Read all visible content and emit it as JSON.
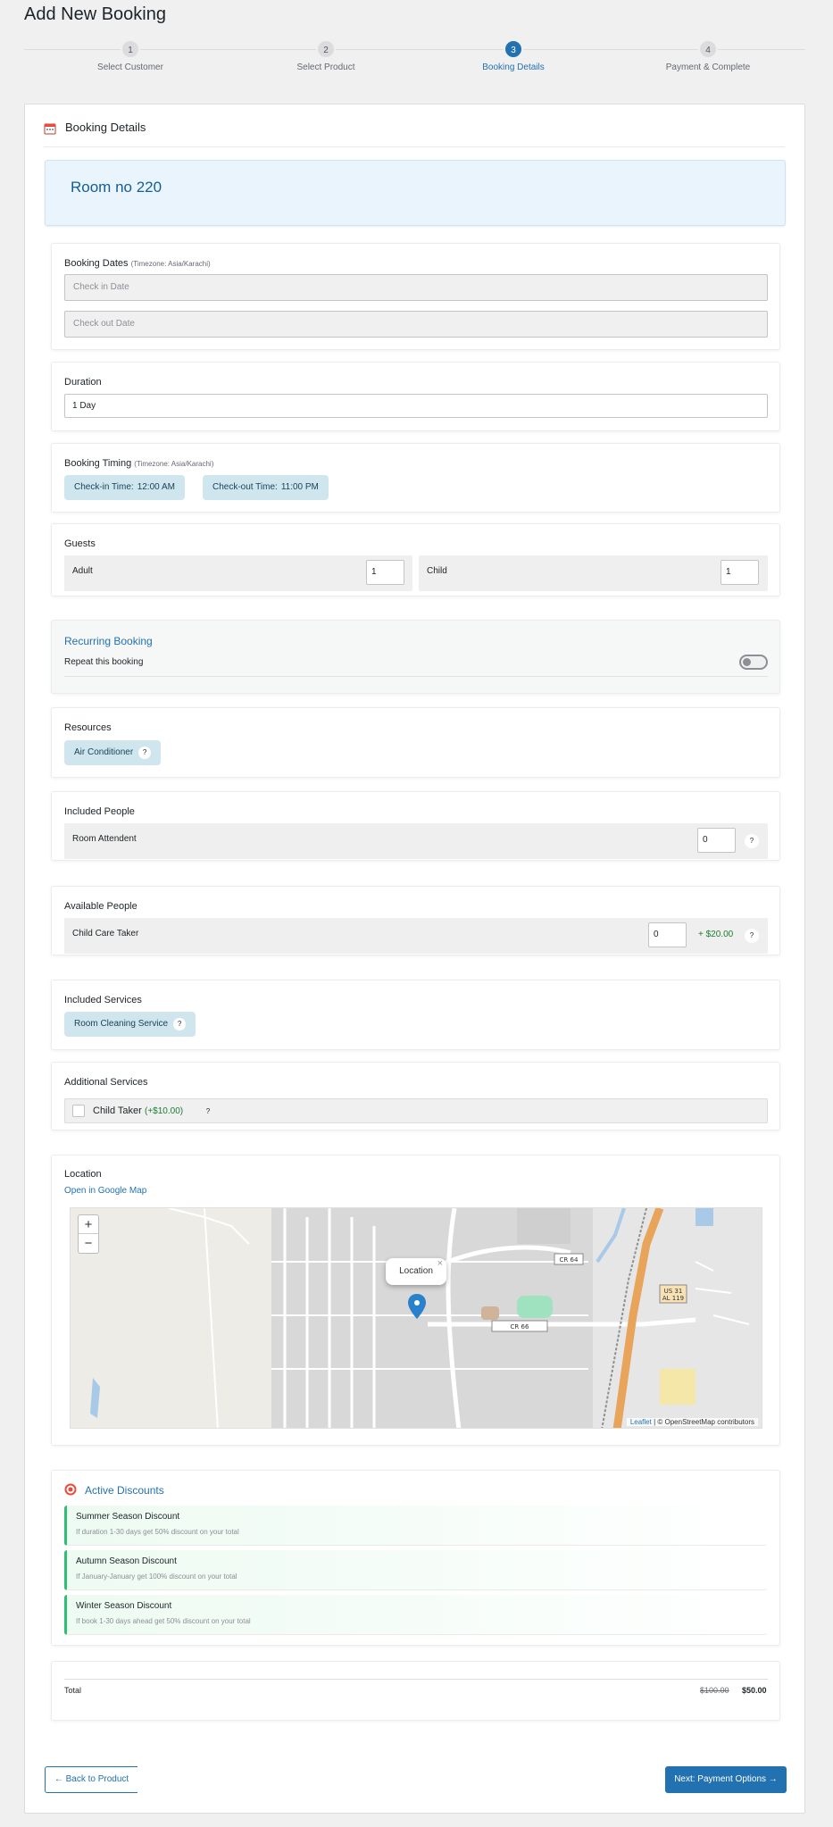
{
  "page": {
    "title": "Add New Booking"
  },
  "steps": [
    {
      "num": "1",
      "label": "Select Customer"
    },
    {
      "num": "2",
      "label": "Select Product"
    },
    {
      "num": "3",
      "label": "Booking Details"
    },
    {
      "num": "4",
      "label": "Payment & Complete"
    }
  ],
  "card": {
    "title": "Booking Details",
    "room": "Room no 220"
  },
  "dates": {
    "heading": "Booking Dates",
    "tz": "(Timezone: Asia/Karachi)",
    "checkin_placeholder": "Check in Date",
    "checkout_placeholder": "Check out Date"
  },
  "duration": {
    "heading": "Duration",
    "value": "1 Day"
  },
  "timing": {
    "heading": "Booking Timing",
    "tz": "(Timezone: Asia/Karachi)",
    "checkin_label": "Check-in Time:",
    "checkin_value": "12:00 AM",
    "checkout_label": "Check-out Time:",
    "checkout_value": "11:00 PM"
  },
  "guests": {
    "heading": "Guests",
    "adult_label": "Adult",
    "adult_value": "1",
    "child_label": "Child",
    "child_value": "1"
  },
  "recurring": {
    "heading": "Recurring Booking",
    "repeat_label": "Repeat this booking"
  },
  "resources": {
    "heading": "Resources",
    "item": "Air Conditioner",
    "help": "?"
  },
  "included_people": {
    "heading": "Included People",
    "item": "Room Attendent",
    "value": "0",
    "help": "?"
  },
  "available_people": {
    "heading": "Available People",
    "item": "Child Care Taker",
    "value": "0",
    "price": "+ $20.00",
    "help": "?"
  },
  "included_services": {
    "heading": "Included Services",
    "item": "Room Cleaning Service",
    "help": "?"
  },
  "additional_services": {
    "heading": "Additional Services",
    "item": "Child Taker",
    "price": "(+$10.00)",
    "help": "?"
  },
  "location": {
    "heading": "Location",
    "link": "Open in Google Map",
    "popup": "Location",
    "zoom_in": "+",
    "zoom_out": "−",
    "attr_link": "Leaflet",
    "attr_text": "| © OpenStreetMap contributors",
    "labels": {
      "cr64": "CR 64",
      "cr66": "CR 66",
      "us": "US 31",
      "al": "AL 119"
    }
  },
  "discounts": {
    "heading": "Active Discounts",
    "items": [
      {
        "title": "Summer Season Discount",
        "desc": "If duration 1-30 days get 50% discount on your total"
      },
      {
        "title": "Autumn Season Discount",
        "desc": "If January-January get 100% discount on your total"
      },
      {
        "title": "Winter Season Discount",
        "desc": "If book 1-30 days ahead get 50% discount on your total"
      }
    ]
  },
  "total": {
    "label": "Total",
    "old": "$100.00",
    "new": "$50.00"
  },
  "nav": {
    "back": "← Back to Product",
    "next": "Next: Payment Options →"
  },
  "colors": {
    "accent": "#2271b1",
    "pill": "#cfe6ef",
    "discount_border": "#2fbf71",
    "price_green": "#1a7d2f"
  }
}
